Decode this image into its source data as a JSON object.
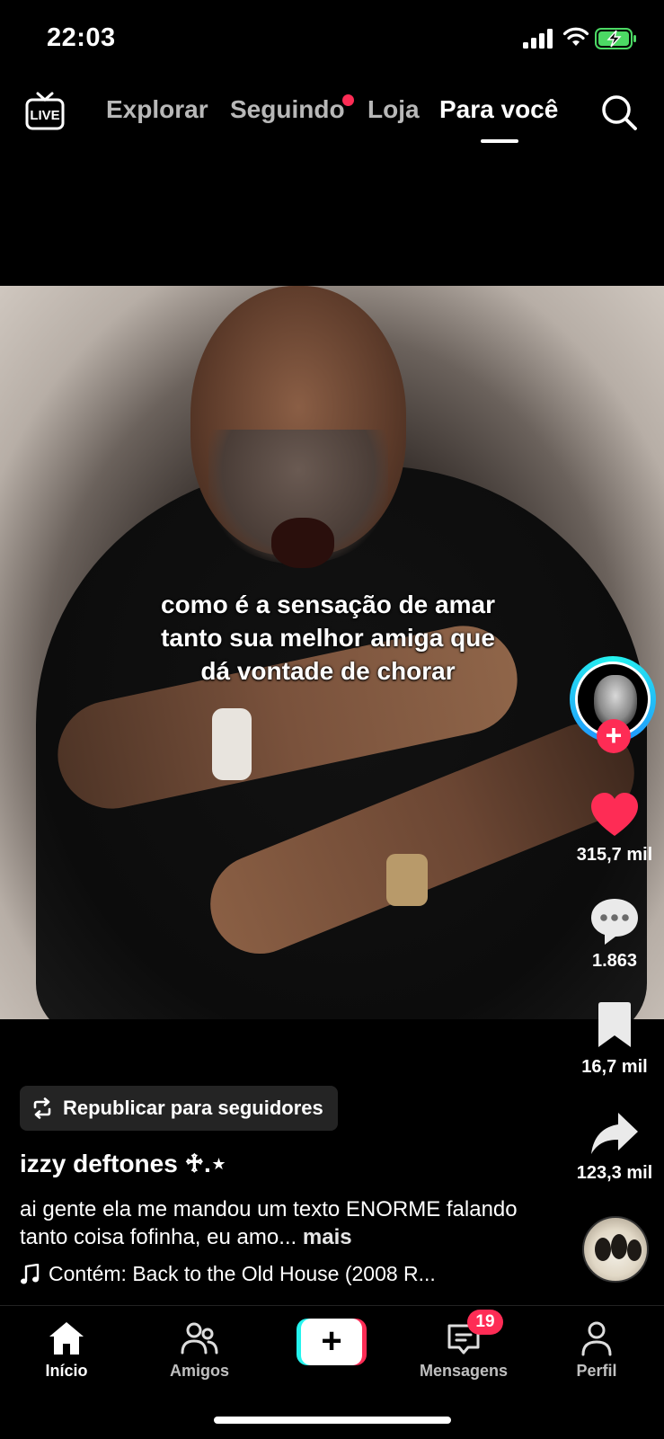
{
  "status_bar": {
    "time": "22:03"
  },
  "top_nav": {
    "tabs": [
      {
        "label": "Explorar"
      },
      {
        "label": "Seguindo"
      },
      {
        "label": "Loja"
      },
      {
        "label": "Para você"
      }
    ],
    "active_tab": "Para você",
    "live_icon": "live-tv-icon",
    "search_icon": "search-icon"
  },
  "video": {
    "caption_lines": [
      "como é a sensação de amar",
      "tanto sua melhor amiga que",
      "dá vontade de chorar"
    ]
  },
  "actions": {
    "likes": "315,7 mil",
    "comments": "1.863",
    "saves": "16,7 mil",
    "shares": "123,3 mil"
  },
  "post": {
    "repost_label": "Republicar para seguidores",
    "username": "izzy deftones ♱.⋆",
    "description": "ai gente ela me mandou um texto ENORME falando tanto coisa fofinha, eu amo...",
    "more_label": "mais",
    "sound": "Contém: Back to the Old House (2008 R..."
  },
  "bottom_nav": {
    "items": [
      {
        "label": "Início",
        "icon": "home-icon"
      },
      {
        "label": "Amigos",
        "icon": "friends-icon"
      },
      {
        "label": "Mensagens",
        "icon": "messages-icon"
      },
      {
        "label": "Perfil",
        "icon": "profile-icon"
      }
    ],
    "messages_badge": "19"
  },
  "colors": {
    "accent": "#fe2c55",
    "cyan": "#25f4ee",
    "battery": "#4cd964"
  }
}
